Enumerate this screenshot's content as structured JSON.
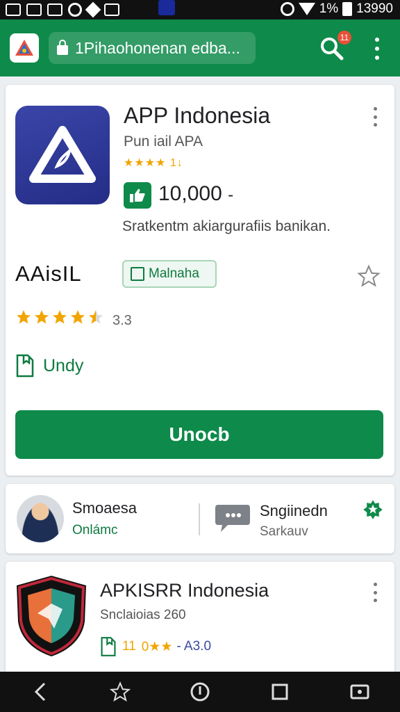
{
  "status_bar": {
    "battery_text": "1%",
    "time": "13990"
  },
  "browser": {
    "url_text": "1Pihaohonenan edba...",
    "search_badge": "11"
  },
  "main_app": {
    "title": "APP Indonesia",
    "developer": "Pun iail APA",
    "mini_rating_text": "★★★★ 1↓",
    "downloads": "10,000",
    "downloads_suffix": "-",
    "description": "Sratkentm akiargurafiis banikan.",
    "section_label": "AAisIL",
    "chip_label": "Malnaha",
    "rating_stars": 4.5,
    "rating_value": "3.3",
    "update_label": "Undy",
    "primary_button": "Unocb"
  },
  "pair_card": {
    "left_title": "Smoaesa",
    "left_subtitle": "Onlámc",
    "right_title": "Sngiinedn",
    "right_subtitle": "Sarkauv"
  },
  "second_app": {
    "title": "APKISRR Indonesia",
    "subtitle": "Snclaioias 260",
    "count": "11",
    "stars_text": "0★★",
    "rating_text": "- A3.0"
  },
  "colors": {
    "brand_green": "#0e8a4a",
    "star_gold": "#f2a400",
    "icon_navy": "#2a338f"
  },
  "icons": [
    "search-icon",
    "lock-icon",
    "kebab-icon",
    "thumbs-up-icon",
    "star-outline-icon",
    "document-icon",
    "chat-icon",
    "shield-icon",
    "back-icon",
    "home-icon",
    "recents-icon"
  ]
}
